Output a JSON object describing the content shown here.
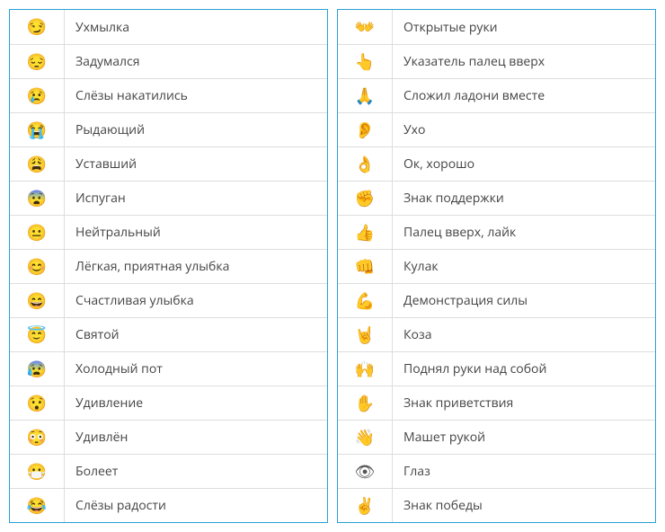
{
  "left": [
    {
      "emoji": "😏",
      "label": "Ухмылка"
    },
    {
      "emoji": "😔",
      "label": "Задумался"
    },
    {
      "emoji": "😢",
      "label": "Слёзы накатились"
    },
    {
      "emoji": "😭",
      "label": "Рыдающий"
    },
    {
      "emoji": "😩",
      "label": "Уставший"
    },
    {
      "emoji": "😨",
      "label": "Испуган"
    },
    {
      "emoji": "😐",
      "label": "Нейтральный"
    },
    {
      "emoji": "😊",
      "label": "Лёгкая, приятная улыбка"
    },
    {
      "emoji": "😄",
      "label": "Счастливая улыбка"
    },
    {
      "emoji": "😇",
      "label": "Святой"
    },
    {
      "emoji": "😰",
      "label": "Холодный пот"
    },
    {
      "emoji": "😯",
      "label": "Удивление"
    },
    {
      "emoji": "😳",
      "label": "Удивлён"
    },
    {
      "emoji": "😷",
      "label": "Болеет"
    },
    {
      "emoji": "😂",
      "label": "Слёзы радости"
    }
  ],
  "right": [
    {
      "emoji": "👐",
      "label": "Открытые руки"
    },
    {
      "emoji": "👆",
      "label": "Указатель палец вверх"
    },
    {
      "emoji": "🙏",
      "label": "Сложил ладони вместе"
    },
    {
      "emoji": "👂",
      "label": "Ухо"
    },
    {
      "emoji": "👌",
      "label": "Ок, хорошо"
    },
    {
      "emoji": "✊",
      "label": "Знак поддержки"
    },
    {
      "emoji": "👍",
      "label": "Палец вверх, лайк"
    },
    {
      "emoji": "👊",
      "label": "Кулак"
    },
    {
      "emoji": "💪",
      "label": "Демонстрация силы"
    },
    {
      "emoji": "🤘",
      "label": "Коза"
    },
    {
      "emoji": "🙌",
      "label": "Поднял руки над собой"
    },
    {
      "emoji": "✋",
      "label": "Знак приветствия"
    },
    {
      "emoji": "👋",
      "label": "Машет рукой"
    },
    {
      "emoji": "👁",
      "label": "Глаз"
    },
    {
      "emoji": "✌",
      "label": "Знак победы"
    }
  ]
}
